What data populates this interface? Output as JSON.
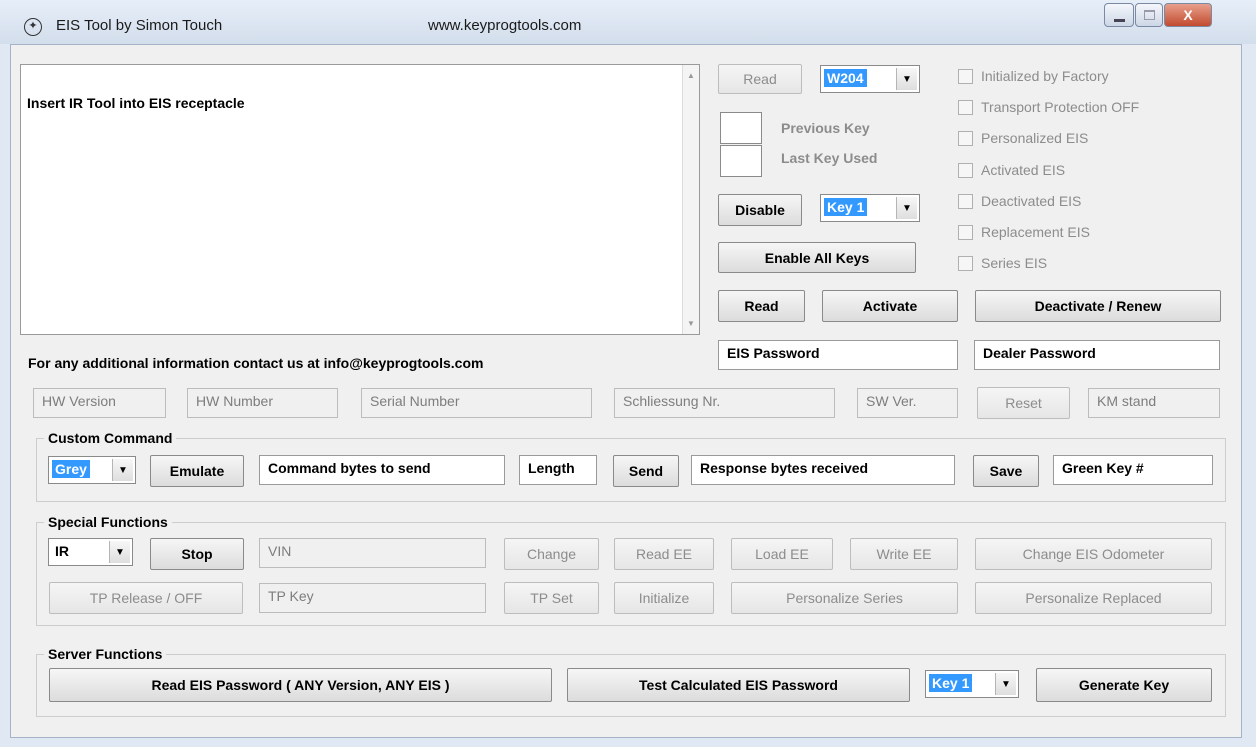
{
  "window": {
    "title": "EIS Tool by Simon Touch",
    "url": "www.keyprogtools.com",
    "close_glyph": "X"
  },
  "log": {
    "text": "Insert IR Tool into EIS receptacle",
    "contact": "For any additional information contact us at info@keyprogtools.com"
  },
  "top": {
    "read_label": "Read",
    "model_select": "W204",
    "previous_key_label": "Previous Key",
    "last_key_used_label": "Last Key Used",
    "disable_label": "Disable",
    "key_select": "Key 1",
    "enable_all_label": "Enable All Keys",
    "read2_label": "Read",
    "activate_label": "Activate",
    "deactivate_label": "Deactivate / Renew",
    "eis_password": "EIS Password",
    "dealer_password": "Dealer Password"
  },
  "status": {
    "items": [
      "Initialized by Factory",
      "Transport Protection OFF",
      "Personalized EIS",
      "Activated EIS",
      "Deactivated EIS",
      "Replacement EIS",
      "Series EIS"
    ]
  },
  "info": {
    "hw_version": "HW Version",
    "hw_number": "HW Number",
    "serial_number": "Serial Number",
    "schliessung": "Schliessung Nr.",
    "sw_ver": "SW Ver.",
    "reset_label": "Reset",
    "km_stand": "KM stand"
  },
  "custom": {
    "title": "Custom Command",
    "color_select": "Grey",
    "emulate_label": "Emulate",
    "command_bytes": "Command bytes to send",
    "length": "Length",
    "send_label": "Send",
    "response_bytes": "Response bytes received",
    "save_label": "Save",
    "green_key": "Green Key #"
  },
  "special": {
    "title": "Special Functions",
    "mode_select": "IR",
    "stop_label": "Stop",
    "vin": "VIN",
    "change_label": "Change",
    "read_ee_label": "Read EE",
    "load_ee_label": "Load EE",
    "write_ee_label": "Write EE",
    "change_odometer_label": "Change EIS Odometer",
    "tp_release_label": "TP Release / OFF",
    "tp_key": "TP Key",
    "tp_set_label": "TP Set",
    "initialize_label": "Initialize",
    "personalize_series_label": "Personalize Series",
    "personalize_replaced_label": "Personalize Replaced"
  },
  "server": {
    "title": "Server Functions",
    "read_eis_password_label": "Read EIS Password ( ANY Version, ANY EIS )",
    "test_calculated_label": "Test Calculated EIS Password",
    "key_select": "Key 1",
    "generate_key_label": "Generate Key"
  }
}
